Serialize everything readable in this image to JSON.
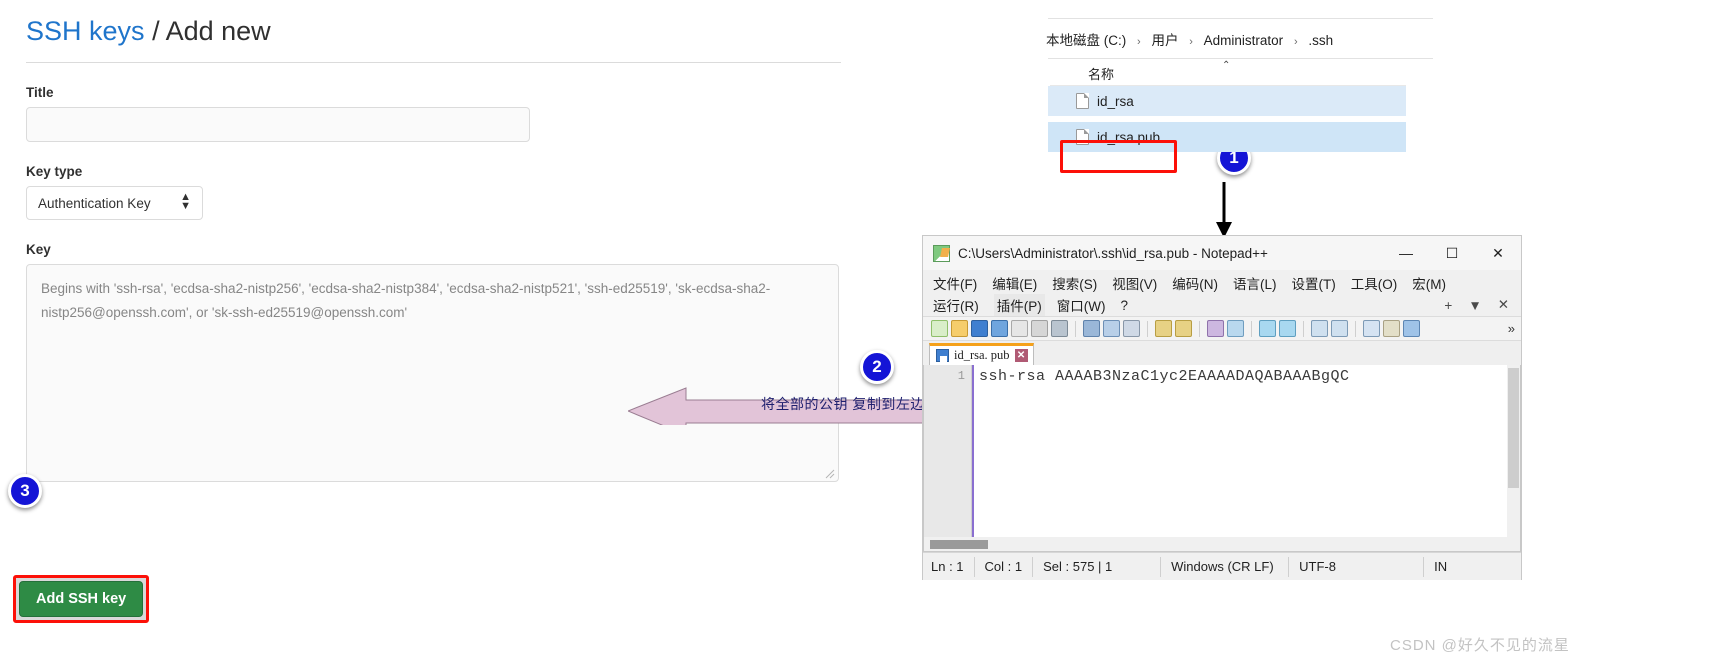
{
  "gitlab": {
    "title_link": "SSH keys",
    "title_sep": "/",
    "title_rest": "Add new",
    "title_field_label": "Title",
    "title_field_value": "",
    "title_field_placeholder": "",
    "key_type_label": "Key type",
    "key_type_value": "Authentication Key",
    "key_label": "Key",
    "key_placeholder": "Begins with 'ssh-rsa', 'ecdsa-sha2-nistp256', 'ecdsa-sha2-nistp384', 'ecdsa-sha2-nistp521', 'ssh-ed25519', 'sk-ecdsa-sha2-nistp256@openssh.com', or 'sk-ssh-ed25519@openssh.com'",
    "submit_label": "Add SSH key"
  },
  "badges": {
    "one": "1",
    "two": "2",
    "three": "3"
  },
  "annotation": {
    "arrow_text": "将全部的公钥 复制到左边"
  },
  "explorer": {
    "breadcrumb": [
      "本地磁盘 (C:)",
      "用户",
      "Administrator",
      ".ssh"
    ],
    "chevron": "›",
    "column_header": "名称",
    "sort_caret": "⌃",
    "files": [
      {
        "name": "id_rsa"
      },
      {
        "name": "id_rsa.pub"
      }
    ]
  },
  "notepad": {
    "title": "C:\\Users\\Administrator\\.ssh\\id_rsa.pub - Notepad++",
    "window_controls": {
      "minimize": "—",
      "maximize": "☐",
      "close": "✕"
    },
    "menu_row1": [
      "文件(F)",
      "编辑(E)",
      "搜索(S)",
      "视图(V)",
      "编码(N)",
      "语言(L)",
      "设置(T)",
      "工具(O)",
      "宏(M)"
    ],
    "menu_row2": [
      "运行(R)",
      "插件(P)",
      "窗口(W)",
      "?"
    ],
    "menu_right": [
      "+",
      "▼",
      "✕"
    ],
    "toolbar_overflow": "»",
    "tab_label": "id_rsa. pub",
    "tab_close": "✕",
    "line_number": "1",
    "code_line": "ssh-rsa AAAAB3NzaC1yc2EAAAADAQABAAABgQC",
    "status": {
      "ln": "Ln : 1",
      "col": "Col : 1",
      "sel": "Sel : 575 | 1",
      "eol": "Windows (CR LF)",
      "encoding": "UTF-8",
      "insert": "IN"
    }
  },
  "watermark": "CSDN @好久不见的流星",
  "colors": {
    "link_blue": "#1f75cb",
    "badge_blue": "#1414d6",
    "red_highlight": "#fc1008",
    "green_button": "#2e8b45",
    "arrow_pink": "#e2c4d8"
  }
}
